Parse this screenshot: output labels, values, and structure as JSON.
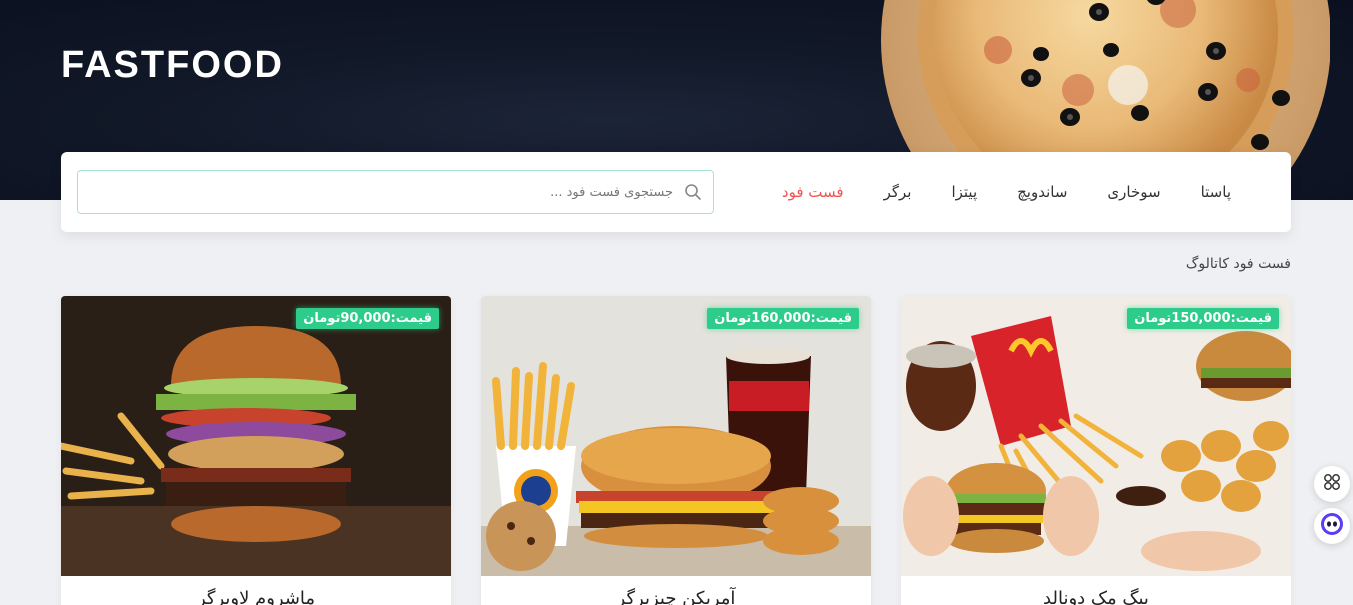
{
  "brand": {
    "name": "FASTFOOD"
  },
  "nav": {
    "items": [
      {
        "label": "فست فود",
        "active": true
      },
      {
        "label": "برگر",
        "active": false
      },
      {
        "label": "پیتزا",
        "active": false
      },
      {
        "label": "ساندویچ",
        "active": false
      },
      {
        "label": "سوخاری",
        "active": false
      },
      {
        "label": "پاستا",
        "active": false
      }
    ]
  },
  "search": {
    "placeholder": "جستجوی فست فود ...",
    "value": ""
  },
  "catalog": {
    "title": "فست فود کاتالوگ"
  },
  "products": [
    {
      "price": "قیمت:150,000تومان",
      "name": "بیگ مک دونالد"
    },
    {
      "price": "قیمت:160,000تومان",
      "name": "آمریکن چیزبرگر"
    },
    {
      "price": "قیمت:90,000تومان",
      "name": "ماشروم لاوبرگر"
    }
  ],
  "colors": {
    "accent": "#ef5350",
    "price_badge": "#2ecc8a",
    "hero_bg": "#111827"
  },
  "icons": {
    "search": "search-icon",
    "apps": "grid-icon",
    "assistant": "robot-icon"
  }
}
